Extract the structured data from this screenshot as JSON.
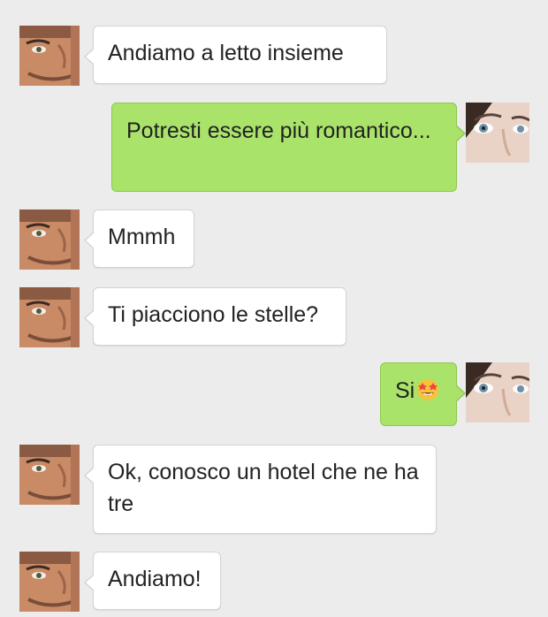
{
  "chat": {
    "messages": [
      {
        "sender": "man",
        "text": "Andiamo a letto insieme"
      },
      {
        "sender": "woman",
        "text": "Potresti essere più romantico..."
      },
      {
        "sender": "man",
        "text": "Mmmh"
      },
      {
        "sender": "man",
        "text": "Ti piacciono le stelle?"
      },
      {
        "sender": "woman",
        "text": "Si",
        "emoji": "star-struck-emoji"
      },
      {
        "sender": "man",
        "text": "Ok, conosco un hotel che ne ha tre"
      },
      {
        "sender": "man",
        "text": "Andiamo!"
      }
    ]
  },
  "colors": {
    "background": "#ececec",
    "incoming_bubble": "#ffffff",
    "outgoing_bubble": "#a9e36a",
    "text": "#222222"
  },
  "icons": {
    "man_avatar": "man-avatar-icon",
    "woman_avatar": "woman-avatar-icon",
    "emoji": "star-struck-emoji-icon"
  }
}
